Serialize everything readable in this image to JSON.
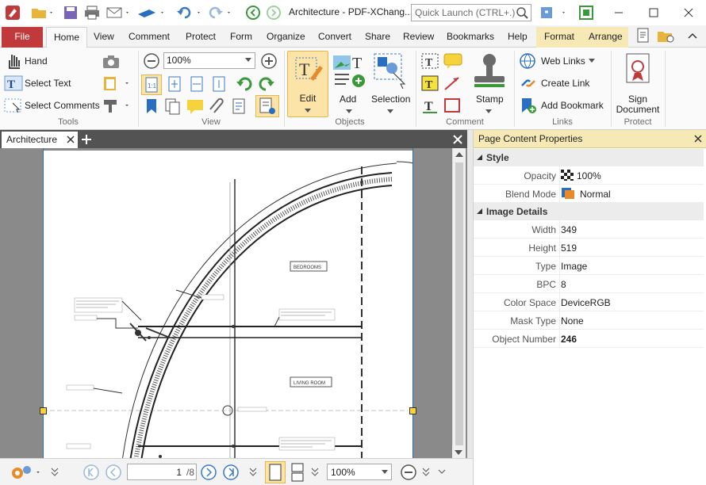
{
  "window": {
    "title": "Architecture - PDF-XChang...",
    "quick_launch_placeholder": "Quick Launch (CTRL+.)"
  },
  "tabs": [
    "File",
    "Home",
    "View",
    "Comment",
    "Protect",
    "Form",
    "Organize",
    "Convert",
    "Share",
    "Review",
    "Bookmarks",
    "Help",
    "Format",
    "Arrange"
  ],
  "ribbon": {
    "tools": {
      "hand": "Hand",
      "select_text": "Select Text",
      "select_comments": "Select Comments",
      "label": "Tools"
    },
    "view": {
      "zoom": "100%",
      "label": "View"
    },
    "objects": {
      "edit": "Edit",
      "add": "Add",
      "selection": "Selection",
      "label": "Objects"
    },
    "comment": {
      "stamp": "Stamp",
      "label": "Comment"
    },
    "links": {
      "web_links": "Web Links",
      "create_link": "Create Link",
      "add_bookmark": "Add Bookmark",
      "label": "Links"
    },
    "protect": {
      "sign_line1": "Sign",
      "sign_line2": "Document",
      "label": "Protect"
    }
  },
  "document": {
    "tab_name": "Architecture",
    "labels": {
      "bedrooms": "BEDROOMS",
      "living_room": "LIVING ROOM"
    }
  },
  "statusbar": {
    "page_current": "1",
    "page_total": "/8",
    "zoom": "100%"
  },
  "panel": {
    "title": "Page Content Properties",
    "style_section": "Style",
    "image_section": "Image Details",
    "style_rows": [
      {
        "key": "Opacity",
        "value": "100%"
      },
      {
        "key": "Blend Mode",
        "value": "Normal"
      }
    ],
    "image_rows": [
      {
        "key": "Width",
        "value": "349"
      },
      {
        "key": "Height",
        "value": "519"
      },
      {
        "key": "Type",
        "value": "Image"
      },
      {
        "key": "BPC",
        "value": "8"
      },
      {
        "key": "Color Space",
        "value": "DeviceRGB"
      },
      {
        "key": "Mask Type",
        "value": "None"
      },
      {
        "key": "Object Number",
        "value": "246"
      }
    ]
  },
  "colors": {
    "file_tab": "#c0393b",
    "context_tab": "#f6e9b6",
    "accent_blue": "#2a6fbf"
  }
}
